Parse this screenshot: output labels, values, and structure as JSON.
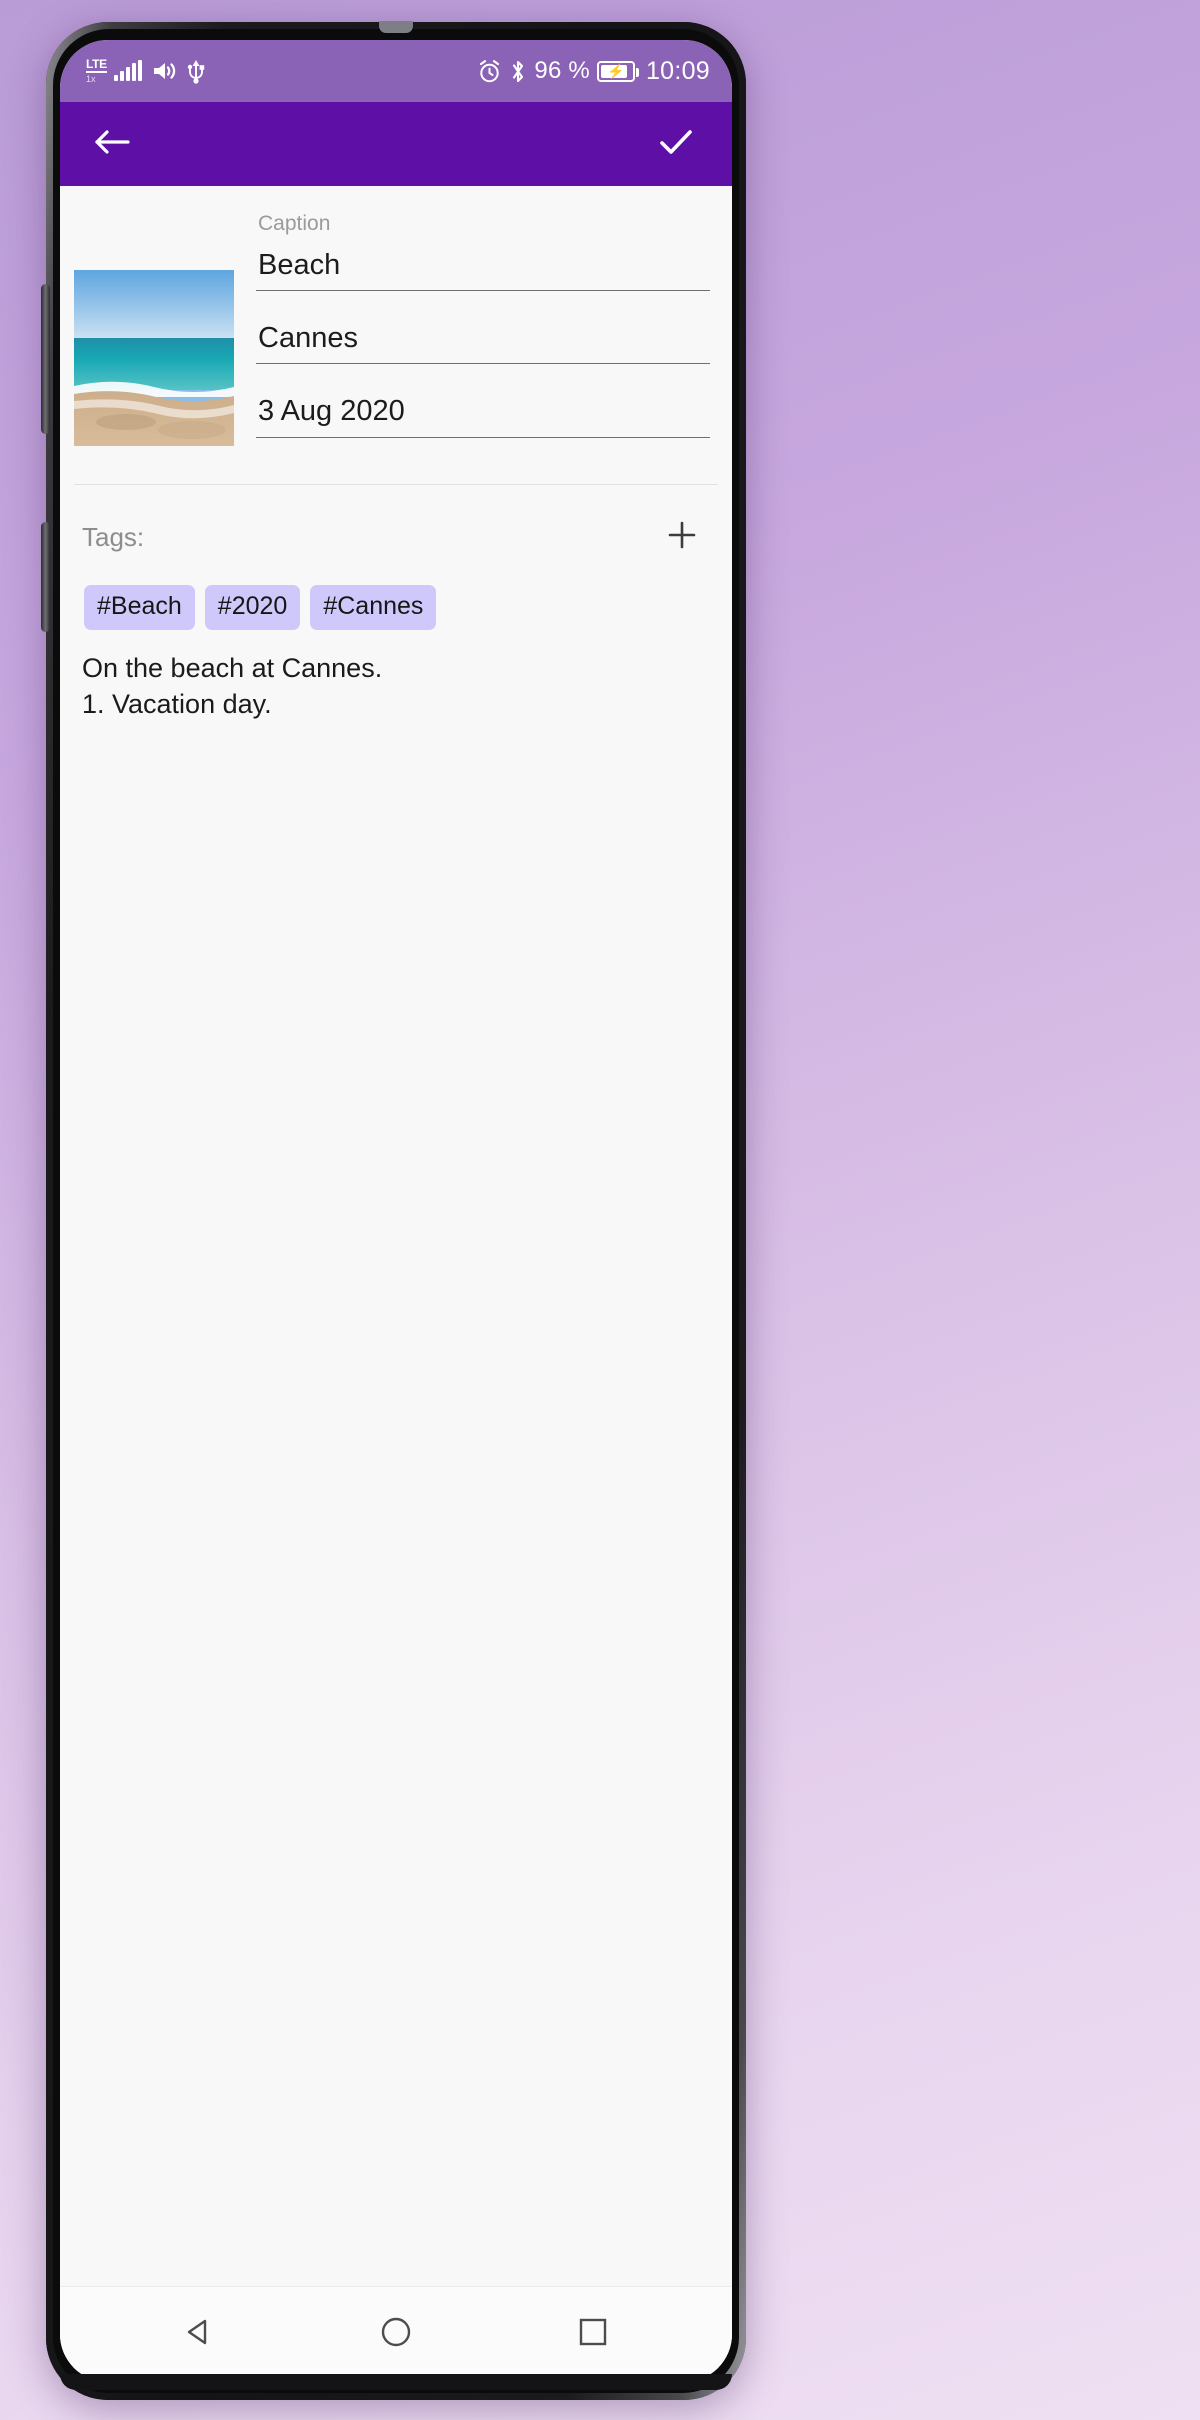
{
  "status_bar": {
    "network_type": "LTE",
    "network_sub": "1x",
    "icons": [
      "signal-bars",
      "volume-icon",
      "usb-icon",
      "alarm-icon",
      "bluetooth-icon"
    ],
    "battery_percent": "96 %",
    "battery_charging": true,
    "time": "10:09",
    "background_color": "#8b63b6"
  },
  "app_bar": {
    "back_icon": "back-arrow-icon",
    "confirm_icon": "check-icon",
    "background_color": "#5e10a6"
  },
  "form": {
    "caption_label": "Caption",
    "fields": [
      {
        "name": "caption",
        "value": "Beach"
      },
      {
        "name": "location",
        "value": "Cannes"
      },
      {
        "name": "date",
        "value": "3 Aug 2020"
      }
    ]
  },
  "photo": {
    "alt": "beach-photo-thumbnail"
  },
  "tags": {
    "title": "Tags:",
    "add_label": "+",
    "items": [
      "#Beach",
      "#2020",
      "#Cannes"
    ],
    "chip_color": "#cfc8fb"
  },
  "note": {
    "text": "On the beach at Cannes.\n1. Vacation day."
  },
  "nav_bar": {
    "back_label": "back-triangle-icon",
    "home_label": "home-circle-icon",
    "recents_label": "recents-square-icon"
  }
}
